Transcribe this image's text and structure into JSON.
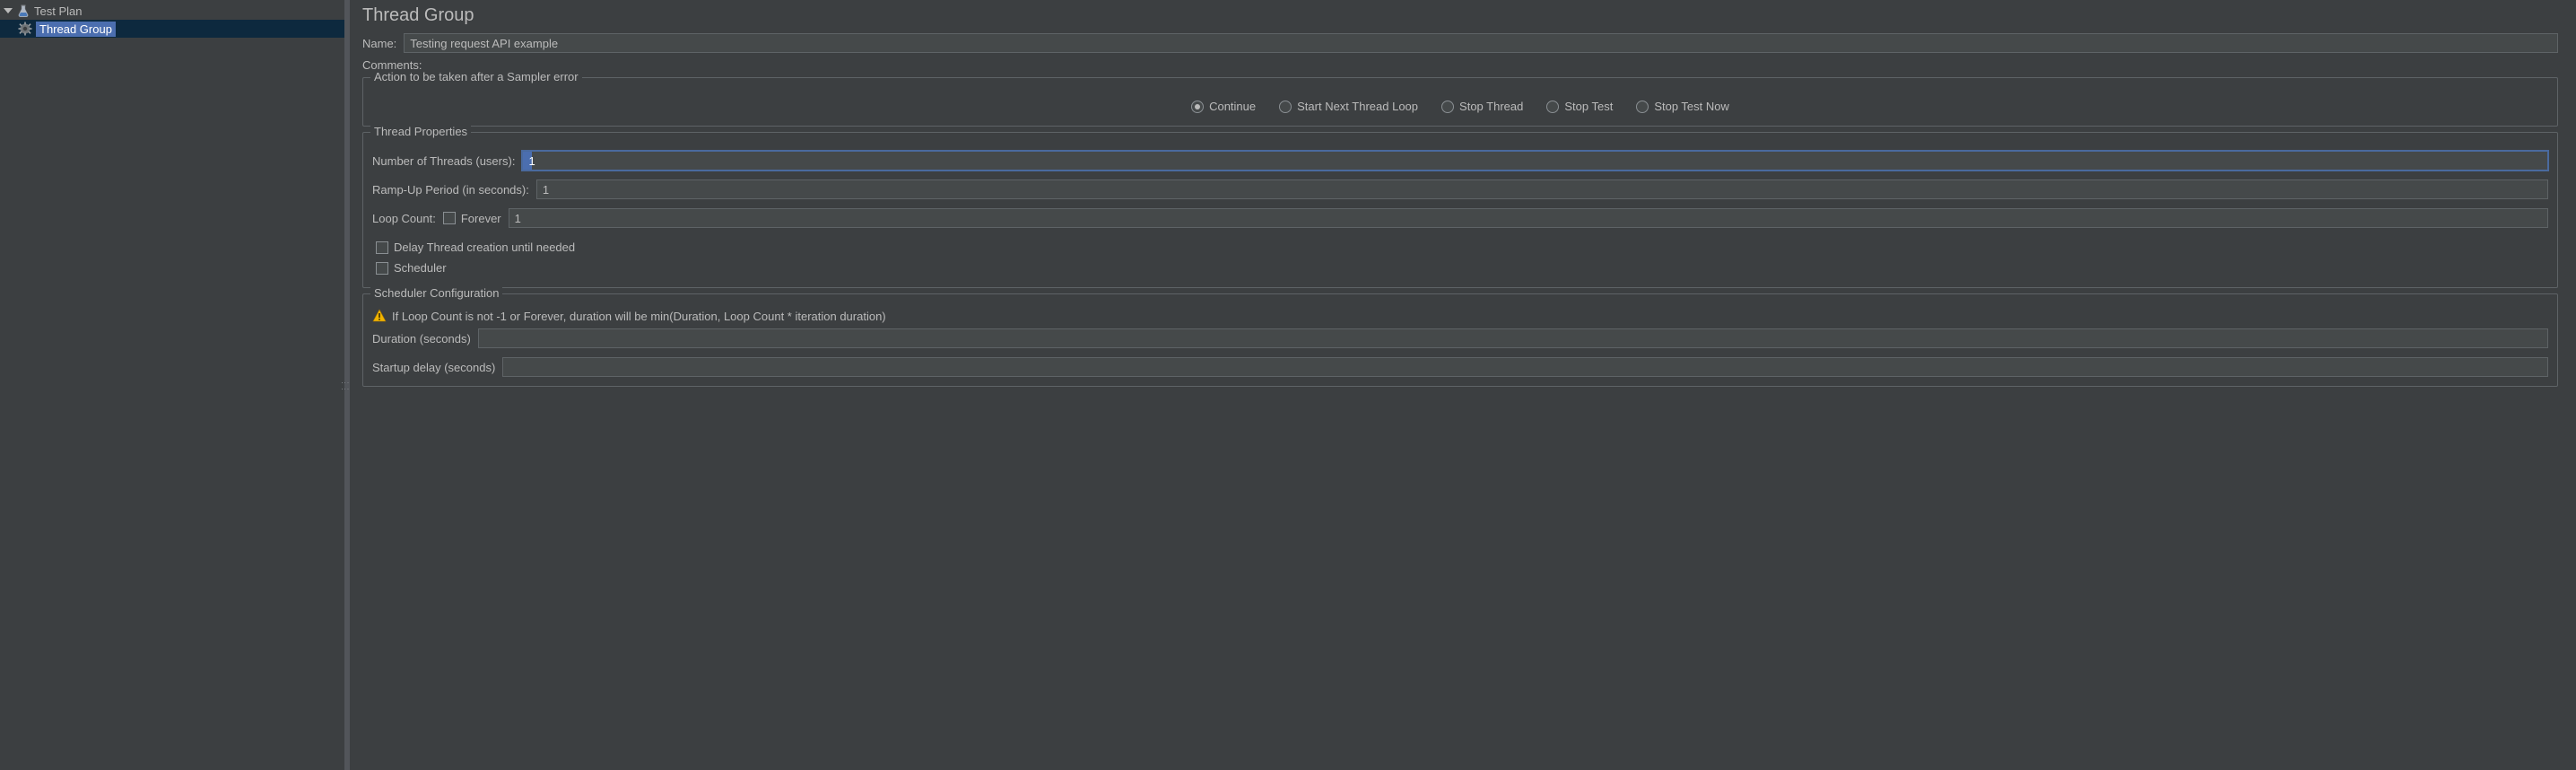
{
  "tree": {
    "root_label": "Test Plan",
    "child_label": "Thread Group"
  },
  "main": {
    "title": "Thread Group",
    "name_label": "Name:",
    "name_value": "Testing request API example",
    "comments_label": "Comments:"
  },
  "sampler_error": {
    "legend": "Action to be taken after a Sampler error",
    "options": {
      "continue": "Continue",
      "start_next": "Start Next Thread Loop",
      "stop_thread": "Stop Thread",
      "stop_test": "Stop Test",
      "stop_test_now": "Stop Test Now"
    },
    "selected": "continue"
  },
  "thread_props": {
    "legend": "Thread Properties",
    "num_threads_label": "Number of Threads (users):",
    "num_threads_value": "1",
    "ramp_up_label": "Ramp-Up Period (in seconds):",
    "ramp_up_value": "1",
    "loop_count_label": "Loop Count:",
    "forever_label": "Forever",
    "loop_count_value": "1",
    "delay_thread_label": "Delay Thread creation until needed",
    "scheduler_label": "Scheduler"
  },
  "sched_config": {
    "legend": "Scheduler Configuration",
    "warn_text": "If Loop Count is not -1 or Forever, duration will be min(Duration, Loop Count * iteration duration)",
    "duration_label": "Duration (seconds)",
    "duration_value": "",
    "startup_delay_label": "Startup delay (seconds)",
    "startup_delay_value": ""
  }
}
